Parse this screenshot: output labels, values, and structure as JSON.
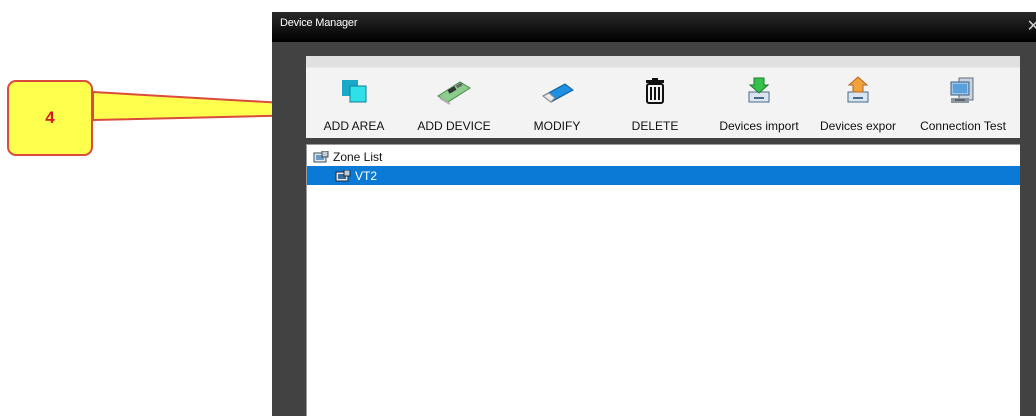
{
  "callout": {
    "number": "4"
  },
  "window": {
    "title": "Device Manager",
    "close_glyph": "✕"
  },
  "toolbar": {
    "buttons": [
      {
        "label": "ADD AREA",
        "icon": "add-area-icon"
      },
      {
        "label": "ADD DEVICE",
        "icon": "add-device-icon"
      },
      {
        "label": "MODIFY",
        "icon": "modify-icon"
      },
      {
        "label": "DELETE",
        "icon": "trash-icon"
      },
      {
        "label": "Devices import",
        "icon": "import-icon"
      },
      {
        "label": "Devices expor",
        "icon": "export-icon"
      },
      {
        "label": "Connection  Test",
        "icon": "connection-test-icon"
      }
    ]
  },
  "tree": {
    "root_label": "Zone List",
    "items": [
      {
        "label": "VT2",
        "selected": true
      }
    ]
  },
  "colors": {
    "selection": "#0a7ad6",
    "callout_fill": "#ffff4d",
    "callout_border": "#d94b3a"
  }
}
